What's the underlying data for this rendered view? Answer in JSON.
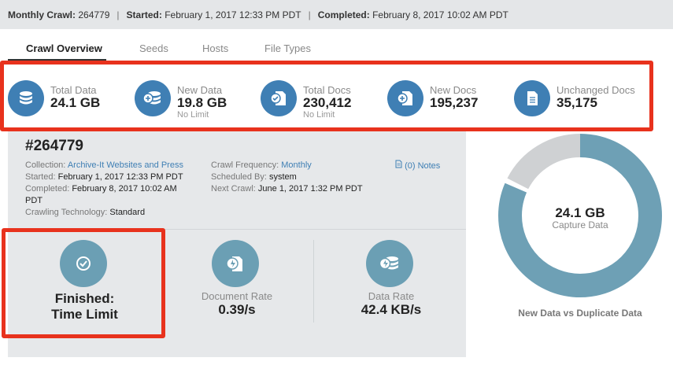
{
  "topbar": {
    "crawl_key": "Monthly Crawl:",
    "crawl_val": "264779",
    "started_key": "Started:",
    "started_val": "February 1, 2017 12:33 PM PDT",
    "completed_key": "Completed:",
    "completed_val": "February 8, 2017 10:02 AM PDT",
    "separator": "|"
  },
  "tabs": [
    "Crawl Overview",
    "Seeds",
    "Hosts",
    "File Types"
  ],
  "stats": [
    {
      "label": "Total Data",
      "value": "24.1 GB",
      "sub": "",
      "icon": "database-icon"
    },
    {
      "label": "New Data",
      "value": "19.8 GB",
      "sub": "No Limit",
      "icon": "database-add-icon"
    },
    {
      "label": "Total Docs",
      "value": "230,412",
      "sub": "No Limit",
      "icon": "document-check-icon"
    },
    {
      "label": "New Docs",
      "value": "195,237",
      "sub": "",
      "icon": "document-add-icon"
    },
    {
      "label": "Unchanged Docs",
      "value": "35,175",
      "sub": "",
      "icon": "document-icon"
    }
  ],
  "crawl": {
    "id": "#264779",
    "collection_key": "Collection:",
    "collection_val": "Archive-It Websites and Press",
    "started_key": "Started:",
    "started_val": "February 1, 2017 12:33 PM PDT",
    "completed_key": "Completed:",
    "completed_val": "February 8, 2017 10:02 AM",
    "completed_val2": "PDT",
    "technology_key": "Crawling Technology:",
    "technology_val": "Standard",
    "frequency_key": "Crawl Frequency:",
    "frequency_val": "Monthly",
    "scheduled_key": "Scheduled By:",
    "scheduled_val": "system",
    "next_key": "Next Crawl:",
    "next_val": "June 1, 2017 1:32 PM PDT",
    "notes": "(0) Notes"
  },
  "status": {
    "line1": "Finished:",
    "line2": "Time Limit",
    "icon": "check-circle-icon"
  },
  "document_rate": {
    "label": "Document Rate",
    "value": "0.39/s"
  },
  "data_rate": {
    "label": "Data Rate",
    "value": "42.4 KB/s"
  },
  "donut": {
    "value": "24.1 GB",
    "label": "Capture Data",
    "title": "New Data vs Duplicate Data",
    "new_fraction": 0.82,
    "colors": {
      "new": "#6ea0b5",
      "duplicate": "#cfd1d3"
    }
  },
  "colors": {
    "accent": "#3f7fb4",
    "highlight": "#e8321d"
  }
}
